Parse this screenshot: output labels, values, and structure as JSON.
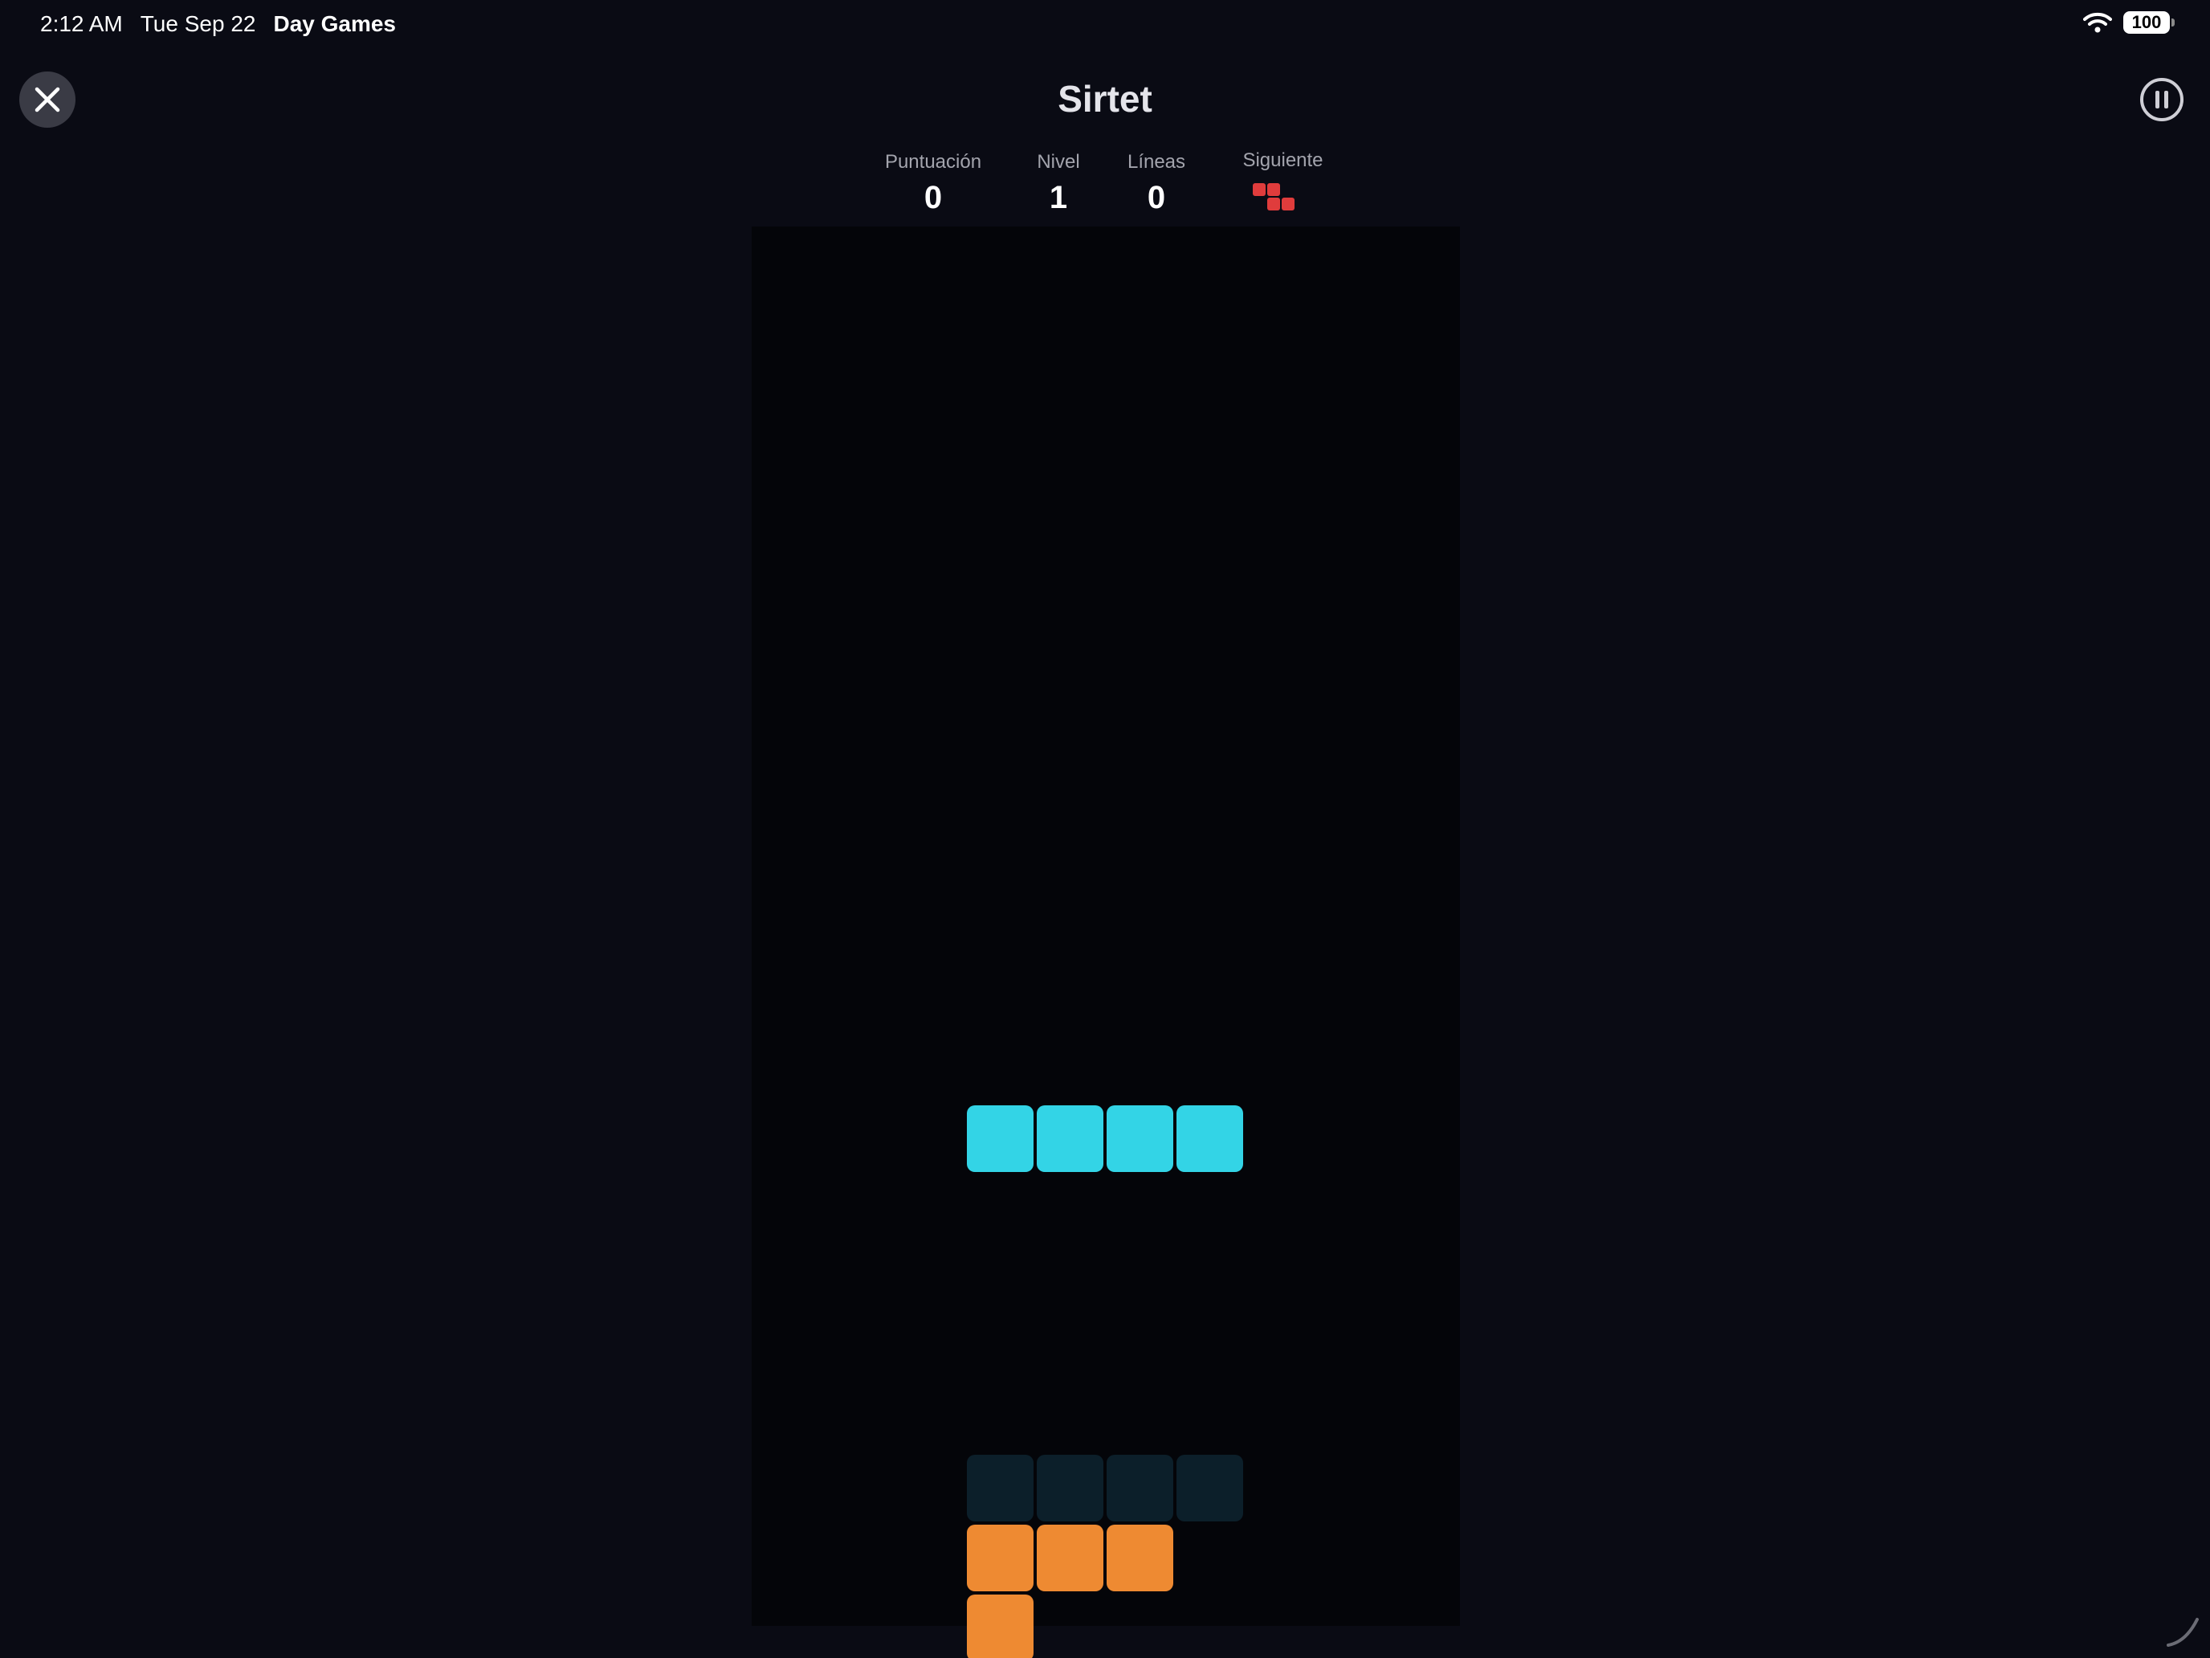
{
  "status_bar": {
    "time": "2:12 AM",
    "date": "Tue Sep 22",
    "app_name": "Day Games",
    "battery": "100",
    "wifi_icon": "wifi-icon"
  },
  "header": {
    "title": "Sirtet",
    "close_icon": "close-icon",
    "pause_icon": "pause-icon"
  },
  "stats": {
    "score_label": "Puntuación",
    "score_value": "0",
    "level_label": "Nivel",
    "level_value": "1",
    "lines_label": "Líneas",
    "lines_value": "0",
    "next_label": "Siguiente",
    "next_piece": "Z",
    "next_piece_color": "#e03c3c"
  },
  "board": {
    "columns": 10,
    "rows": 20,
    "active_piece": {
      "type": "I",
      "color": "#33d4e6",
      "cells": [
        [
          3,
          12
        ],
        [
          4,
          12
        ],
        [
          5,
          12
        ],
        [
          6,
          12
        ]
      ]
    },
    "ghost_piece": {
      "color": "#0c1f2a",
      "cells": [
        [
          3,
          17
        ],
        [
          4,
          17
        ],
        [
          5,
          17
        ],
        [
          6,
          17
        ]
      ]
    },
    "locked_cells": {
      "color": "#ee8a32",
      "cells": [
        [
          3,
          18
        ],
        [
          4,
          18
        ],
        [
          5,
          18
        ],
        [
          3,
          19
        ]
      ]
    }
  },
  "colors": {
    "background": "#0a0b14",
    "board_background": "#040509"
  }
}
